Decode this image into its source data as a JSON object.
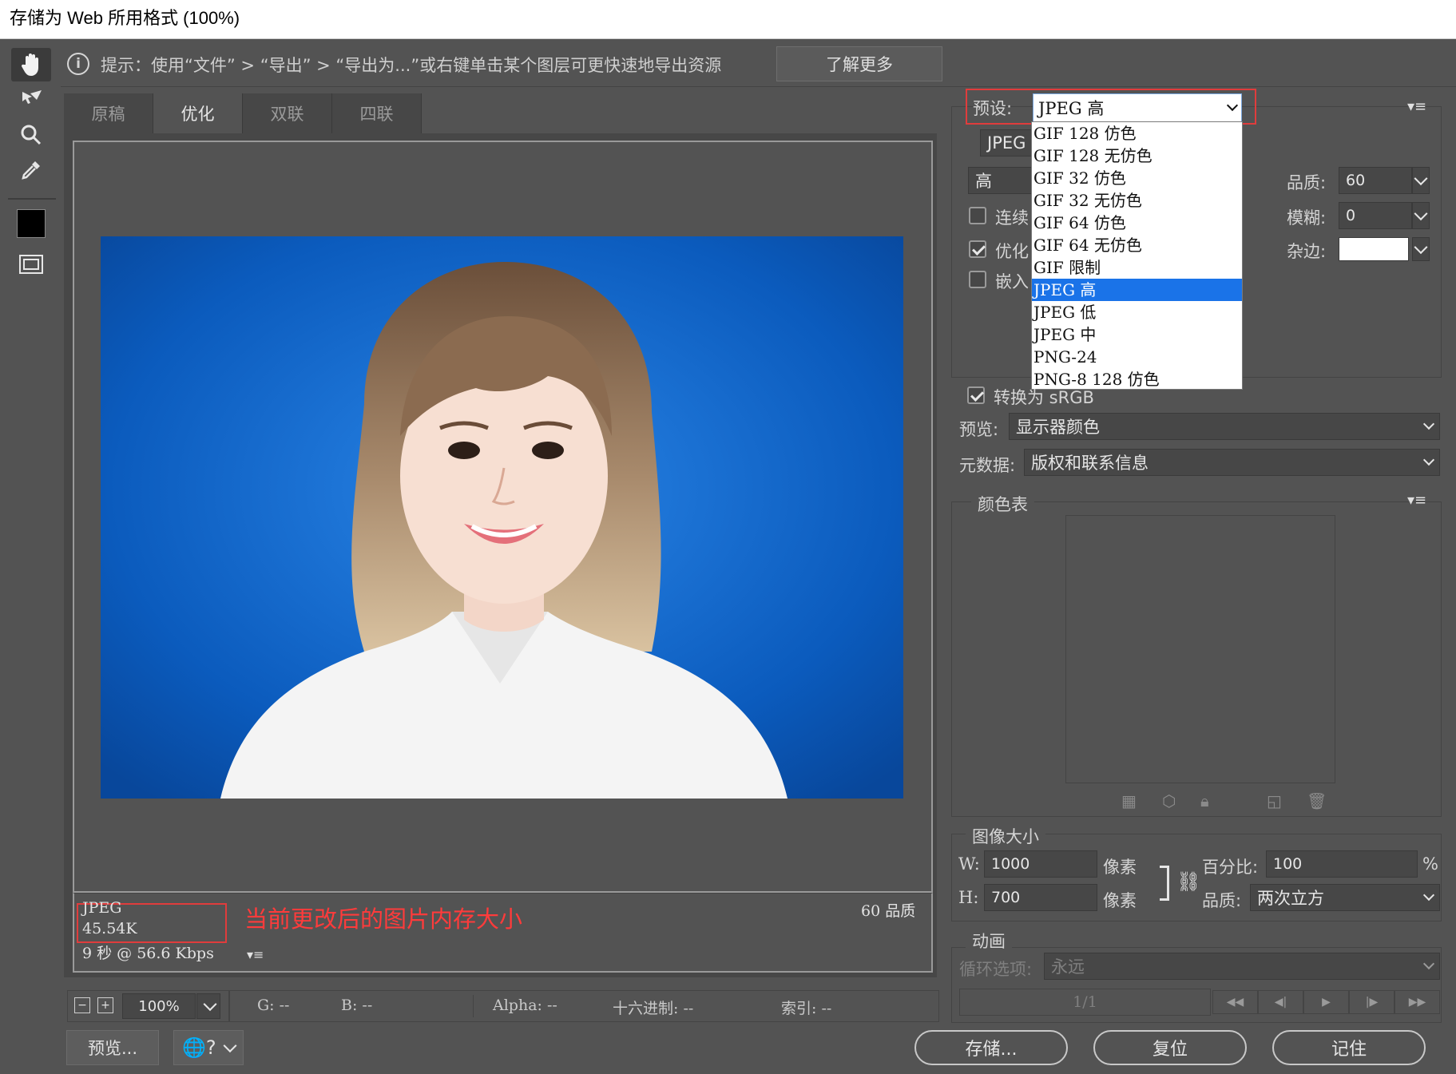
{
  "window": {
    "title": "存储为 Web 所用格式 (100%)"
  },
  "hint": {
    "text": "提示：使用“文件” > “导出” > “导出为...”或右键单击某个图层可更快速地导出资源",
    "learn_more": "了解更多"
  },
  "tabs": [
    "原稿",
    "优化",
    "双联",
    "四联"
  ],
  "image_info": {
    "format": "JPEG",
    "size": "45.54K",
    "speed": "9 秒 @ 56.6 Kbps",
    "quality_right": "60 品质",
    "annotation": "当前更改后的图片内存大小"
  },
  "statusbar": {
    "zoom": "100%",
    "g": "G: --",
    "b": "B: --",
    "alpha": "Alpha: --",
    "hex": "十六进制: --",
    "index": "索引: --"
  },
  "bottom_buttons": {
    "preview": "预览...",
    "save": "存储...",
    "reset": "复位",
    "remember": "记住"
  },
  "settings": {
    "preset_label": "预设:",
    "preset_value": "JPEG 高",
    "format_value": "JPEG",
    "quality_level": "高",
    "progressive_label": "连续",
    "optimized_label": "优化",
    "embed_label": "嵌入",
    "quality_label": "品质:",
    "quality_value": "60",
    "blur_label": "模糊:",
    "blur_value": "0",
    "matte_label": "杂边:",
    "convert_srgb_label": "转换为 sRGB",
    "preview_label": "预览:",
    "preview_value": "显示器颜色",
    "metadata_label": "元数据:",
    "metadata_value": "版权和联系信息"
  },
  "preset_options": [
    "GIF 128 仿色",
    "GIF 128 无仿色",
    "GIF 32 仿色",
    "GIF 32 无仿色",
    "GIF 64 仿色",
    "GIF 64 无仿色",
    "GIF 限制",
    "JPEG 高",
    "JPEG 低",
    "JPEG 中",
    "PNG-24",
    "PNG-8 128 仿色"
  ],
  "selected_preset_index": 7,
  "color_table": {
    "title": "颜色表"
  },
  "image_size": {
    "title": "图像大小",
    "w_label": "W:",
    "w_value": "1000",
    "h_label": "H:",
    "h_value": "700",
    "unit": "像素",
    "percent_label": "百分比:",
    "percent_value": "100",
    "percent_sign": "%",
    "quality_label": "品质:",
    "quality_value": "两次立方"
  },
  "animation": {
    "title": "动画",
    "loop_label": "循环选项:",
    "loop_value": "永远",
    "frame": "1/1"
  },
  "colors": {
    "bg": "#535353",
    "accent": "#1a73e8",
    "annotation_red": "#ff3b3b",
    "photo_bg": "#0b5bbd"
  }
}
